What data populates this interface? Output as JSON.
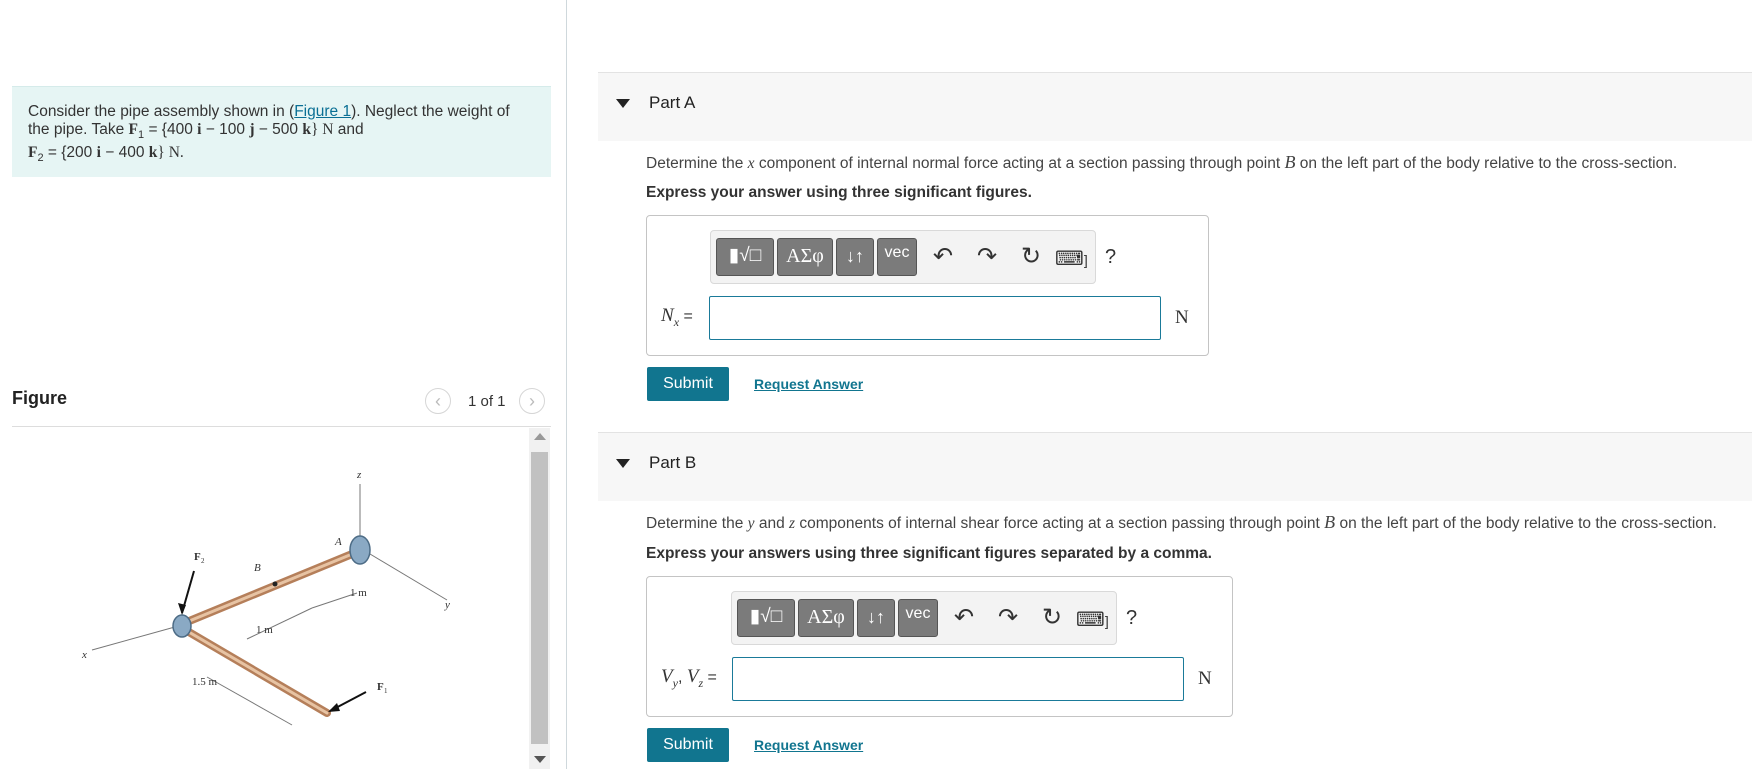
{
  "problem": {
    "line1_pre": "Consider the pipe assembly shown in (",
    "figure_link": "Figure 1",
    "line1_post": "). Neglect the weight of",
    "line2_pre": "the pipe. Take ",
    "f1_symbol": "F",
    "f1_sub": "1",
    "f1_eq": " = {400 ",
    "f1_i": "i",
    "f1_mid1": " − 100 ",
    "f1_j": "j",
    "f1_mid2": " − 500 ",
    "f1_k": "k",
    "f1_unit": "} N",
    "line2_and": " and",
    "f2_symbol": "F",
    "f2_sub": "2",
    "f2_eq": " = {200 ",
    "f2_i": "i",
    "f2_mid": " − 400 ",
    "f2_k": "k",
    "f2_unit": "} N."
  },
  "figure_panel": {
    "title": "Figure",
    "prev": "‹",
    "next": "›",
    "page_count": "1 of 1",
    "labels": {
      "z": "z",
      "x": "x",
      "y": "y",
      "A": "A",
      "B": "B",
      "F1": "F",
      "F1_sub": "1",
      "F2": "F",
      "F2_sub": "2",
      "d1": "1 m",
      "d2": "1 m",
      "d3": "1.5 m"
    }
  },
  "toolbar": {
    "template_label": "▮√□",
    "greek_label": "ΑΣφ",
    "arrows_label": "↓↑",
    "vec_label": "vec",
    "undo_icon": "↶",
    "redo_icon": "↷",
    "reset_icon": "↻",
    "keyboard_icon": "⌨",
    "keyboard_suffix": "]",
    "help": "?"
  },
  "partA": {
    "title": "Part A",
    "prompt_1": "Determine the ",
    "prompt_var": "x",
    "prompt_2": " component of internal normal force acting at a section passing through point ",
    "prompt_point": "B",
    "prompt_3": " on the left part of the body relative to the cross-section.",
    "instruction": "Express your answer using three significant figures.",
    "label_var": "N",
    "label_sub": "x",
    "label_eq": " =",
    "unit": "N",
    "input_value": "",
    "submit": "Submit",
    "request": "Request Answer"
  },
  "partB": {
    "title": "Part B",
    "prompt_1": "Determine the ",
    "prompt_var1": "y",
    "prompt_and": " and ",
    "prompt_var2": "z",
    "prompt_2": " components of internal shear force acting at a section passing through point ",
    "prompt_point": "B",
    "prompt_3": " on the left part of the body relative to the cross-section.",
    "instruction": "Express your answers using three significant figures separated by a comma.",
    "label_v1": "V",
    "label_sub1": "y",
    "label_comma": ", ",
    "label_v2": "V",
    "label_sub2": "z",
    "label_eq": " =",
    "unit": "N",
    "input_value": "",
    "submit": "Submit",
    "request": "Request Answer"
  }
}
